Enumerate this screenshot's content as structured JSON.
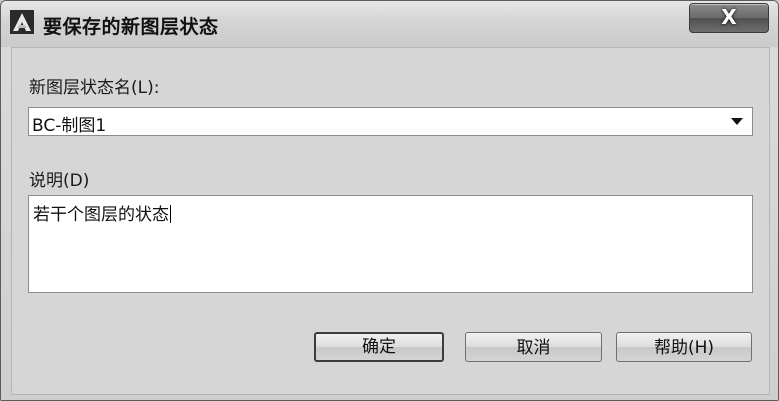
{
  "window": {
    "title": "要保存的新图层状态",
    "close_label": "X",
    "app_icon": "autocad-icon"
  },
  "form": {
    "name_label": "新图层状态名(L):",
    "name_value": "BC-制图1",
    "description_label": "说明(D)",
    "description_value": "若干个图层的状态"
  },
  "buttons": {
    "ok": "确定",
    "cancel": "取消",
    "help": "帮助(H)"
  }
}
